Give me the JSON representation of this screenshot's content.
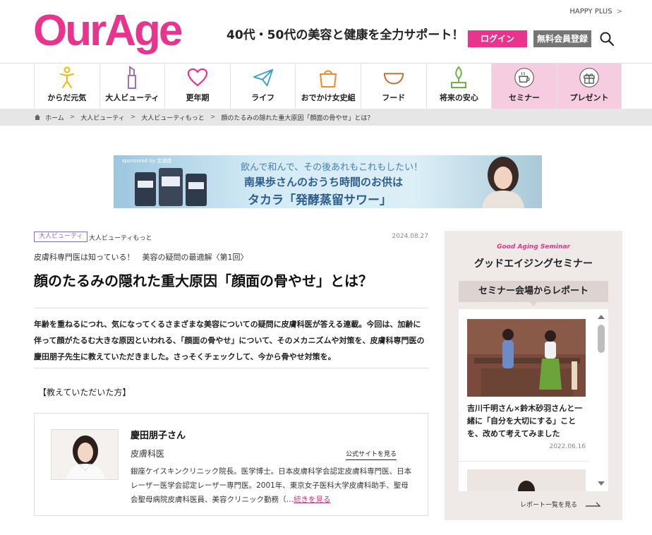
{
  "header": {
    "logo": "OurAge",
    "tagline": "40代・50代の美容と健康を全力サポート！",
    "happy_plus": "HAPPY PLUS",
    "login": "ログイン",
    "register": "無料会員登録"
  },
  "nav": {
    "items": [
      {
        "label": "からだ元気",
        "icon": "person-icon"
      },
      {
        "label": "大人ビューティ",
        "icon": "lipstick-icon"
      },
      {
        "label": "更年期",
        "icon": "heart-icon"
      },
      {
        "label": "ライフ",
        "icon": "paper-plane-icon"
      },
      {
        "label": "おでかけ女史組",
        "icon": "bag-icon"
      },
      {
        "label": "フード",
        "icon": "bowl-icon"
      },
      {
        "label": "将来の安心",
        "icon": "plant-icon"
      },
      {
        "label": "セミナー",
        "icon": "coffee-cup-icon"
      },
      {
        "label": "プレゼント",
        "icon": "gift-icon"
      }
    ],
    "active_color": "#f6cde0"
  },
  "breadcrumb": {
    "items": [
      "ホーム",
      "大人ビューティ",
      "大人ビューティもっと",
      "顔のたるみの隠れた重大原因「顔面の骨やせ」とは？"
    ]
  },
  "banner": {
    "sponsor": "sponsored by 宝酒造",
    "line1": "飲んで和んで、その後あれもこれもしたい！",
    "line2": "南果歩さんのおうち時間のお供は",
    "line3": "タカラ「発酵蒸留サワー」"
  },
  "article": {
    "category_tag": "大人ビューティ",
    "subcategory": "大人ビューティもっと",
    "date": "2024.08.27",
    "series": "皮膚科専門医は知っている！　美容の疑問の最適解〈第1回〉",
    "title": "顔のたるみの隠れた重大原因「顔面の骨やせ」とは？",
    "lead": "年齢を重ねるにつれ、気になってくるさまざまな美容についての疑問に皮膚科医が答える連載。今回は、加齢に伴って顔がたるむ大きな原因といわれる、「顔面の骨やせ」について、そのメカニズムや対策を、皮膚科専門医の慶田朋子先生に教えていただきました。さっそくチェックして、今から骨やせ対策を。",
    "teacher_heading": "【教えていただいた方】",
    "profile": {
      "name": "慶田朋子さん",
      "role": "皮膚科医",
      "official_link": "公式サイトを見る",
      "bio": "銀座ケイスキンクリニック院長。医学博士。日本皮膚科学会認定皮膚科専門医、日本レーザー医学会認定レーザー専門医。2001年、東京女子医科大学皮膚科助手、聖母会聖母病院皮膚科医員、美容クリニック勤務（…",
      "more": "続きを見る"
    }
  },
  "sidebar": {
    "subtitle": "Good Aging Seminar",
    "title": "グッドエイジングセミナー",
    "tab": "セミナー会場からレポート",
    "card": {
      "title": "吉川千明さん×鈴木砂羽さんと一緒に「自分を大切にする」ことを、改めて考えてみました",
      "date": "2022.06.16"
    },
    "report_link": "レポート一覧を見る"
  },
  "colors": {
    "brand_pink": "#e8348c",
    "register_gray": "#757575",
    "tag_purple": "#8d6bb3",
    "sidebar_bg": "#efe9e7"
  }
}
